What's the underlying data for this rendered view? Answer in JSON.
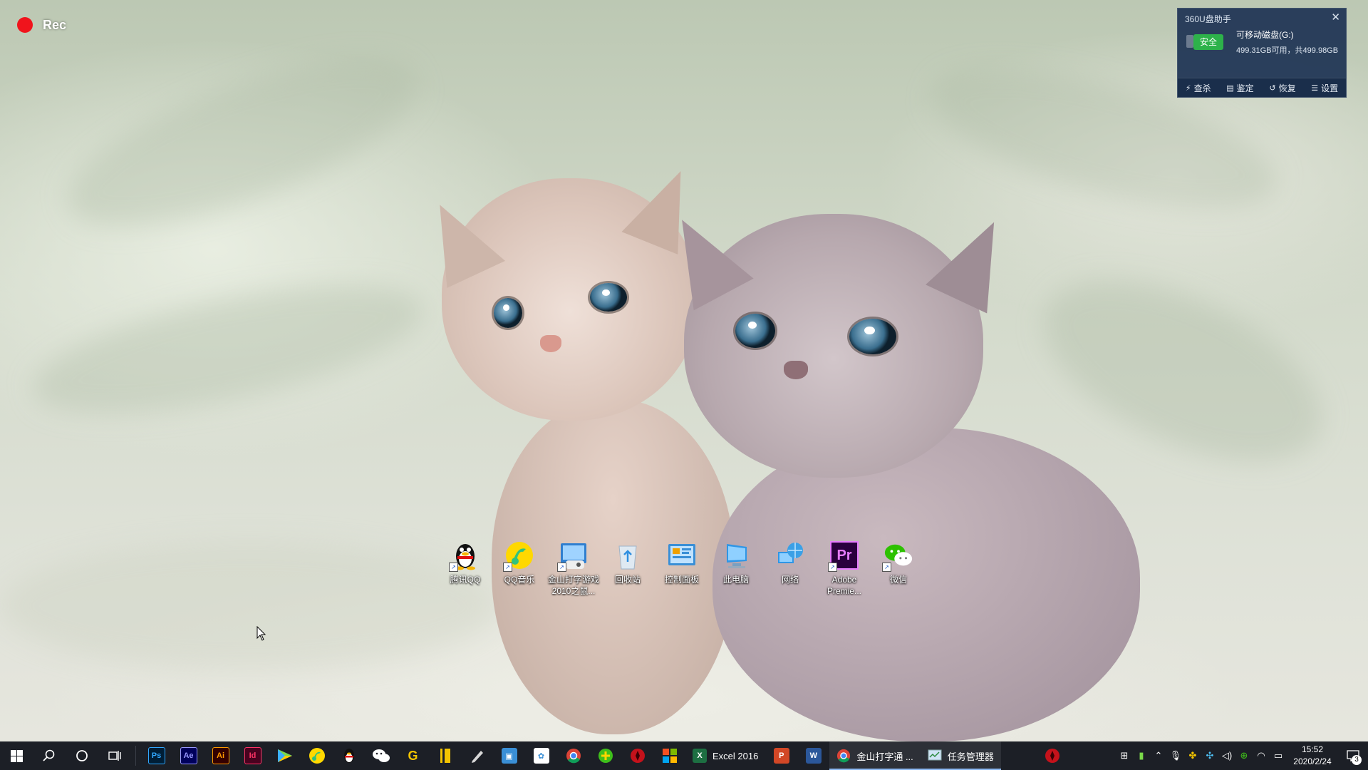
{
  "recorder": {
    "label": "Rec"
  },
  "widget": {
    "title": "360U盘助手",
    "close_icon": "close-icon",
    "safe_badge": "安全",
    "disk_name": "可移动磁盘(G:)",
    "disk_space": "499.31GB可用，共499.98GB",
    "actions": [
      {
        "label": "查杀",
        "icon": "lightning-icon"
      },
      {
        "label": "鉴定",
        "icon": "disk-icon"
      },
      {
        "label": "恢复",
        "icon": "restore-icon"
      },
      {
        "label": "设置",
        "icon": "list-icon"
      }
    ]
  },
  "desktop_icons": [
    {
      "label": "腾讯QQ",
      "icon": "qq-penguin-icon"
    },
    {
      "label": "QQ音乐",
      "icon": "qq-music-icon"
    },
    {
      "label": "金山打字游戏2010之鼠...",
      "icon": "typing-game-icon"
    },
    {
      "label": "回收站",
      "icon": "recycle-bin-icon"
    },
    {
      "label": "控制面板",
      "icon": "control-panel-icon"
    },
    {
      "label": "此电脑",
      "icon": "computer-icon"
    },
    {
      "label": "网络",
      "icon": "network-icon"
    },
    {
      "label": "Adobe Premie...",
      "icon": "premiere-icon",
      "badge_text": "Pr"
    },
    {
      "label": "微信",
      "icon": "wechat-icon"
    }
  ],
  "taskbar": {
    "pinned_apps": [
      {
        "name": "photoshop",
        "text": "Ps",
        "color": "#31a8ff",
        "bg": "#001e36"
      },
      {
        "name": "after-effects",
        "text": "Ae",
        "color": "#9999ff",
        "bg": "#00005b"
      },
      {
        "name": "illustrator",
        "text": "Ai",
        "color": "#ff9a00",
        "bg": "#330000"
      },
      {
        "name": "indesign",
        "text": "Id",
        "color": "#ff3366",
        "bg": "#49021f"
      }
    ],
    "excel": {
      "label": "Excel 2016"
    },
    "typing": {
      "label": "金山打字通 ..."
    },
    "task_manager": {
      "label": "任务管理器"
    },
    "clock": {
      "time": "15:52",
      "date": "2020/2/24"
    },
    "notification_count": "3"
  }
}
